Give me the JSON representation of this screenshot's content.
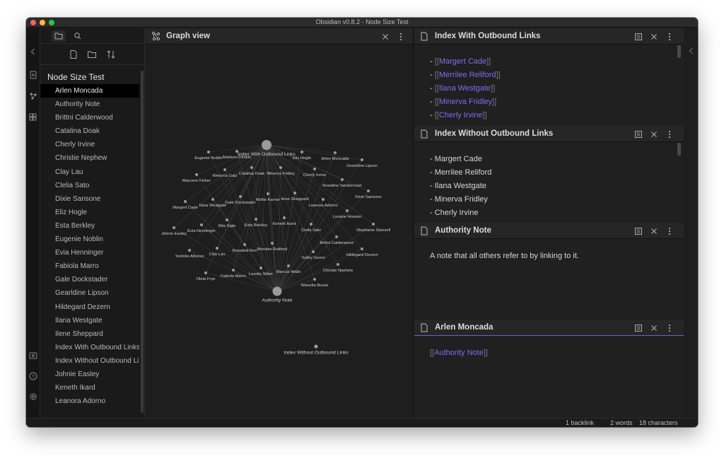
{
  "window": {
    "title": "Obsidian v0.8.2 - Node Size Test"
  },
  "ribbon": {
    "icons": [
      "chevron-left-icon",
      "open-note-icon",
      "graph-icon",
      "plugin-icon",
      "vault-icon",
      "help-icon",
      "settings-icon"
    ]
  },
  "sidebar": {
    "vault_name": "Node Size Test",
    "files": [
      "Arlen Moncada",
      "Authority Note",
      "Brittni Calderwood",
      "Catalina Doak",
      "Cherly Irvine",
      "Christie Nephew",
      "Clay Lau",
      "Clelia Sato",
      "Dixie Sansone",
      "Eliz Hogle",
      "Esta Berkley",
      "Eugenie Noblin",
      "Evia Henninger",
      "Fabiola Marro",
      "Gale Dockstader",
      "Gearldine Lipson",
      "Hildegard Dezern",
      "Ilana Westgate",
      "Ilene Sheppard",
      "Index With Outbound Links",
      "Index Without Outbound Links",
      "Johnie Easley",
      "Keneth Ikard",
      "Leanora Adorno"
    ],
    "selected_file": "Arlen Moncada"
  },
  "graph_pane": {
    "title": "Graph view",
    "nodes": [
      {
        "label": "Index With Outbound Links"
      },
      {
        "label": "Authority Note"
      },
      {
        "label": "Index Without Outbound Links"
      },
      {
        "label": "Eugenie Noblin"
      },
      {
        "label": "Marleen Dimkin"
      },
      {
        "label": "Eliz Hogle"
      },
      {
        "label": "Arlen Moncada"
      },
      {
        "label": "Gearldine Lipson"
      },
      {
        "label": "Marcene Fisher"
      },
      {
        "label": "Wenona Gatz"
      },
      {
        "label": "Catalina Doak"
      },
      {
        "label": "Minerva Fridley"
      },
      {
        "label": "Cherly Irvine"
      },
      {
        "label": "Roseline Vandervoort"
      },
      {
        "label": "Margert Cade"
      },
      {
        "label": "Ilana Westgate"
      },
      {
        "label": "Gale Dockstader"
      },
      {
        "label": "Mollie Karner"
      },
      {
        "label": "Ilene Sheppard"
      },
      {
        "label": "Leanora Adorno"
      },
      {
        "label": "Dixie Sansone"
      },
      {
        "label": "Loraine Hoosier"
      },
      {
        "label": "Johnie Easley"
      },
      {
        "label": "Evia Henninger"
      },
      {
        "label": "Rita Siple"
      },
      {
        "label": "Esta Berkley"
      },
      {
        "label": "Keneth Ikard"
      },
      {
        "label": "Clelia Sato"
      },
      {
        "label": "Stephanie Stansell"
      },
      {
        "label": "Brittni Calderwood"
      },
      {
        "label": "Yoshiko Alfonso"
      },
      {
        "label": "Clay Lau"
      },
      {
        "label": "Rosalind Rex"
      },
      {
        "label": "Merrilee Reliford"
      },
      {
        "label": "Salley Geren"
      },
      {
        "label": "Hildegard Dezern"
      },
      {
        "label": "Oleta Frye"
      },
      {
        "label": "Fabiola Marro"
      },
      {
        "label": "Loretta Silber"
      },
      {
        "label": "Marcus Walls"
      },
      {
        "label": "Christie Nephew"
      },
      {
        "label": "Wanetta Busse"
      }
    ]
  },
  "panes": [
    {
      "title": "Index With Outbound Links",
      "lines": [
        {
          "prefix": "- ",
          "open": "[[",
          "link": "Margert Cade",
          "close": "]]"
        },
        {
          "prefix": "- ",
          "open": "[[",
          "link": "Merrilee Reliford",
          "close": "]]"
        },
        {
          "prefix": "- ",
          "open": "[[",
          "link": "Ilana Westgate",
          "close": "]]"
        },
        {
          "prefix": "- ",
          "open": "[[",
          "link": "Minerva Fridley",
          "close": "]]"
        },
        {
          "prefix": "- ",
          "open": "[[",
          "link": "Cherly Irvine",
          "close": "]]"
        }
      ]
    },
    {
      "title": "Index Without Outbound Links",
      "lines": [
        {
          "text": "- Margert Cade"
        },
        {
          "text": "- Merrilee Reliford"
        },
        {
          "text": "- Ilana Westgate"
        },
        {
          "text": "- Minerva Fridley"
        },
        {
          "text": "- Cherly Irvine"
        }
      ]
    },
    {
      "title": "Authority Note",
      "lines": [
        {
          "text": "A note that all others refer to by linking to it."
        }
      ]
    },
    {
      "title": "Arlen Moncada",
      "lines": [
        {
          "prefix": "",
          "open": "[[",
          "link": "Authority Note",
          "close": "]]"
        }
      ]
    }
  ],
  "status": {
    "backlinks": "1 backlink",
    "words": "2 words",
    "characters": "18 characters"
  },
  "colors": {
    "accent": "#7f6df2",
    "background": "#1e1e1e",
    "selected": "#000000"
  }
}
